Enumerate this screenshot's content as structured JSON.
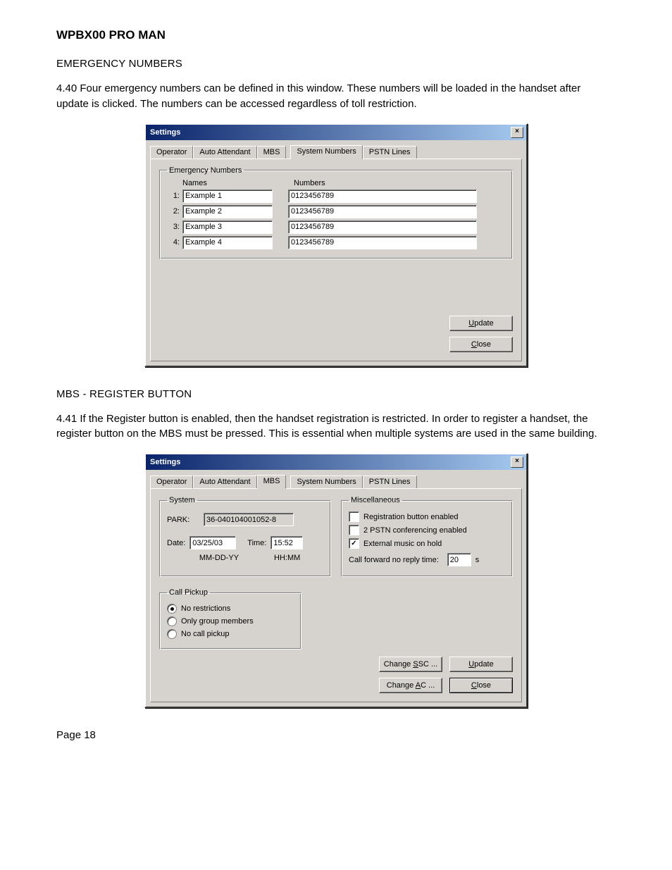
{
  "doc": {
    "title": "WPBX00 PRO MAN",
    "section1_heading": "EMERGENCY NUMBERS",
    "section1_body": "4.40    Four emergency numbers can be defined in this window.  These numbers will be loaded in the handset after update is clicked.  The numbers can be accessed regardless of toll restriction.",
    "section2_heading": "MBS - REGISTER BUTTON",
    "section2_body": "4.41    If the Register button is enabled, then the handset registration is restricted.  In order to register a handset, the register button on the MBS must be pressed.  This is essential when multiple systems are used in the same building.",
    "page_label": "Page 18"
  },
  "dialog1": {
    "title": "Settings",
    "close_glyph": "×",
    "tabs": {
      "operator": "Operator",
      "auto_attendant": "Auto Attendant",
      "mbs": "MBS",
      "system_numbers": "System Numbers",
      "pstn_lines": "PSTN Lines"
    },
    "group_legend": "Emergency Numbers",
    "col_names": "Names",
    "col_numbers": "Numbers",
    "rows": [
      {
        "idx": "1:",
        "name": "Example 1",
        "number": "0123456789"
      },
      {
        "idx": "2:",
        "name": "Example 2",
        "number": "0123456789"
      },
      {
        "idx": "3:",
        "name": "Example 3",
        "number": "0123456789"
      },
      {
        "idx": "4:",
        "name": "Example 4",
        "number": "0123456789"
      }
    ],
    "update_label": "Update",
    "close_label": "Close"
  },
  "dialog2": {
    "title": "Settings",
    "close_glyph": "×",
    "tabs": {
      "operator": "Operator",
      "auto_attendant": "Auto Attendant",
      "mbs": "MBS",
      "system_numbers": "System Numbers",
      "pstn_lines": "PSTN Lines"
    },
    "system": {
      "legend": "System",
      "park_label": "PARK:",
      "park_value": "36-040104001052-8",
      "date_label": "Date:",
      "date_value": "03/25/03",
      "date_hint": "MM-DD-YY",
      "time_label": "Time:",
      "time_value": "15:52",
      "time_hint": "HH:MM"
    },
    "misc": {
      "legend": "Miscellaneous",
      "reg_label": "Registration button enabled",
      "reg_checked": false,
      "conf_label": "2 PSTN conferencing enabled",
      "conf_checked": false,
      "music_label": "External music on hold",
      "music_checked": true,
      "cfnr_label": "Call forward no reply time:",
      "cfnr_value": "20",
      "cfnr_unit": "s"
    },
    "pickup": {
      "legend": "Call Pickup",
      "opt1": "No restrictions",
      "opt2": "Only group members",
      "opt3": "No call pickup",
      "selected": 0
    },
    "buttons": {
      "change_ssc": "Change SSC ...",
      "change_ac": "Change AC ...",
      "update": "Update",
      "close": "Close"
    }
  }
}
